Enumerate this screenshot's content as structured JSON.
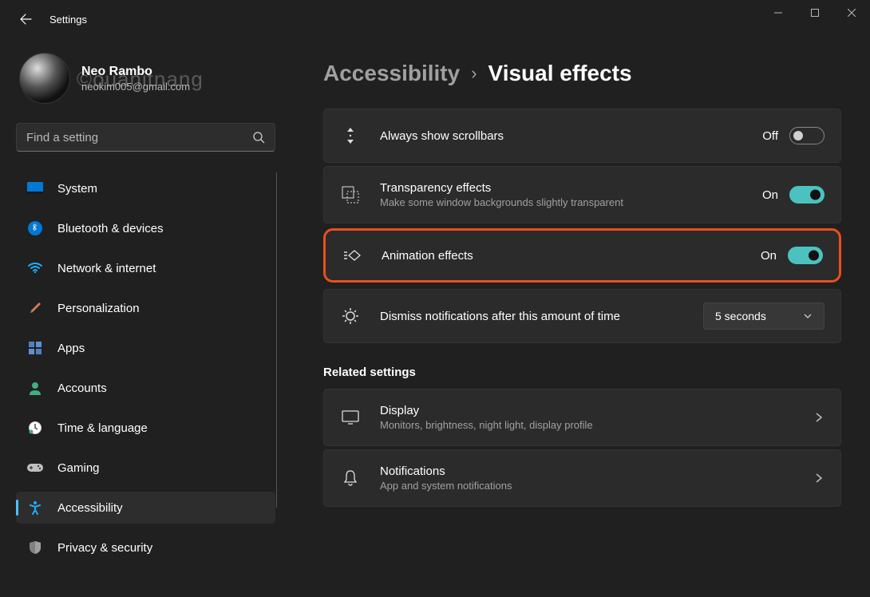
{
  "title": "Settings",
  "user": {
    "name": "Neo Rambo",
    "email": "neokim005@gmail.com"
  },
  "watermark": "©ouänitnang",
  "search": {
    "placeholder": "Find a setting"
  },
  "nav": {
    "items": [
      {
        "label": "System",
        "icon": "system"
      },
      {
        "label": "Bluetooth & devices",
        "icon": "bluetooth"
      },
      {
        "label": "Network & internet",
        "icon": "wifi"
      },
      {
        "label": "Personalization",
        "icon": "brush"
      },
      {
        "label": "Apps",
        "icon": "apps"
      },
      {
        "label": "Accounts",
        "icon": "person"
      },
      {
        "label": "Time & language",
        "icon": "clock"
      },
      {
        "label": "Gaming",
        "icon": "gaming"
      },
      {
        "label": "Accessibility",
        "icon": "accessibility",
        "selected": true
      },
      {
        "label": "Privacy & security",
        "icon": "shield"
      }
    ]
  },
  "breadcrumb": {
    "parent": "Accessibility",
    "current": "Visual effects"
  },
  "settings": {
    "scrollbars": {
      "title": "Always show scrollbars",
      "state": "Off"
    },
    "transparency": {
      "title": "Transparency effects",
      "sub": "Make some window backgrounds slightly transparent",
      "state": "On"
    },
    "animation": {
      "title": "Animation effects",
      "state": "On"
    },
    "dismiss": {
      "title": "Dismiss notifications after this amount of time",
      "value": "5 seconds"
    }
  },
  "related": {
    "header": "Related settings",
    "display": {
      "title": "Display",
      "sub": "Monitors, brightness, night light, display profile"
    },
    "notifications": {
      "title": "Notifications",
      "sub": "App and system notifications"
    }
  }
}
